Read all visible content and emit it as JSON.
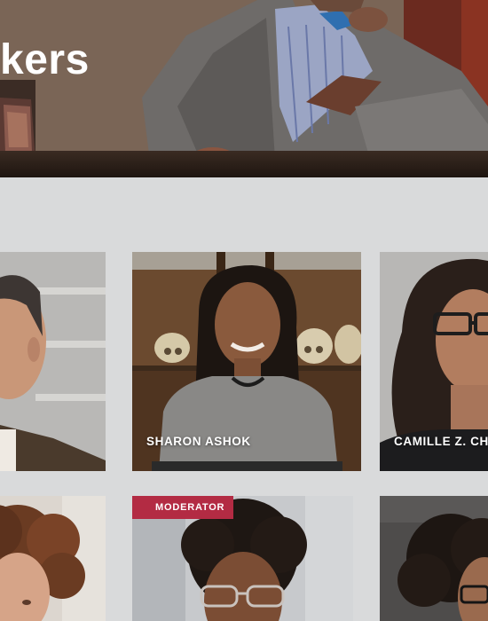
{
  "hero": {
    "title": "kers"
  },
  "speakers": [
    {
      "name": ""
    },
    {
      "name": "SHARON ASHOK"
    },
    {
      "name": "CAMILLE Z. CH"
    },
    {
      "name": ""
    },
    {
      "name": "",
      "badge": "MODERATOR"
    },
    {
      "name": ""
    }
  ],
  "colors": {
    "page_background": "#d9dadb",
    "badge_background": "#b32b43",
    "hero_title": "#ffffff"
  }
}
